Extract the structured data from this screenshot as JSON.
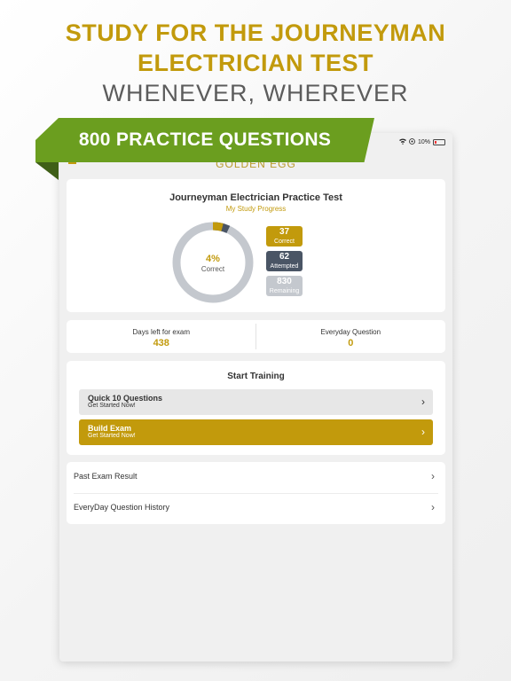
{
  "headline": {
    "line1": "STUDY FOR THE JOURNEYMAN",
    "line2": "ELECTRICIAN TEST",
    "line3": "WHENEVER, WHEREVER"
  },
  "banner": {
    "text": "800 PRACTICE QUESTIONS"
  },
  "status_bar": {
    "battery": "10%"
  },
  "app_bar": {
    "logo": "GOLDEN EGG"
  },
  "progress": {
    "title": "Journeyman Electrician Practice Test",
    "subtitle": "My Study Progress",
    "percent_text": "4%",
    "percent_label": "Correct",
    "percent_value": 4,
    "correct": {
      "value": "37",
      "label": "Correct"
    },
    "attempted": {
      "value": "62",
      "label": "Attempted"
    },
    "remaining": {
      "value": "830",
      "label": "Remaining"
    }
  },
  "exam_info": {
    "days_left_label": "Days left for exam",
    "days_left_value": "438",
    "everyday_label": "Everyday Question",
    "everyday_value": "0"
  },
  "training": {
    "title": "Start Training",
    "quick": {
      "title": "Quick 10 Questions",
      "subtitle": "Get Started Now!"
    },
    "build": {
      "title": "Build Exam",
      "subtitle": "Get Started Now!"
    }
  },
  "history": {
    "past_exam": "Past Exam Result",
    "everyday_history": "EveryDay Question History"
  },
  "colors": {
    "gold": "#c29a0c",
    "banner_green": "#6b9e1f",
    "attempted": "#4a5565",
    "remaining": "#c4c8ce"
  }
}
